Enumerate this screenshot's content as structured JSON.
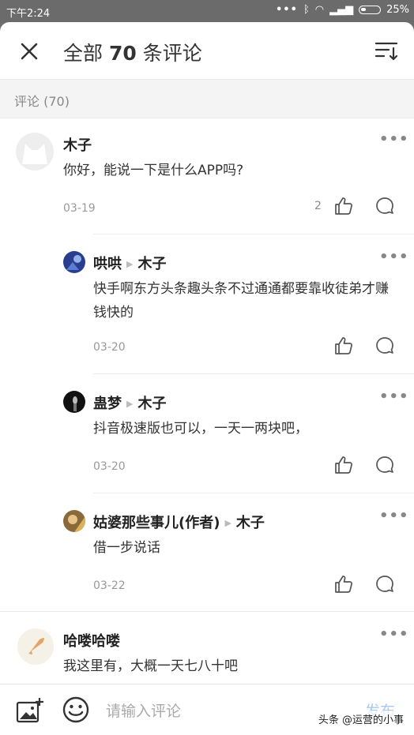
{
  "status_bar": {
    "time": "下午2:24",
    "battery": "25%"
  },
  "header": {
    "title_prefix": "全部",
    "count": "70",
    "title_suffix": "条评论"
  },
  "section": {
    "label": "评论 (70)"
  },
  "comments": [
    {
      "user": "木子",
      "text": "你好，能说一下是什么APP吗?",
      "date": "03-19",
      "likes": "2"
    },
    {
      "user": "哈喽哈喽",
      "text": "我这里有，大概一天七八十吧"
    }
  ],
  "replies": [
    {
      "user": "哄哄",
      "to": "木子",
      "text": "快手啊东方头条趣头条不过通通都要靠收徒弟才赚钱快的",
      "date": "03-20"
    },
    {
      "user": "蛊梦",
      "to": "木子",
      "text": "抖音极速版也可以，一天一两块吧，",
      "date": "03-20"
    },
    {
      "user": "姑婆那些事儿(作者)",
      "to": "木子",
      "text": "借一步说话",
      "date": "03-22"
    }
  ],
  "composer": {
    "placeholder": "请输入评论",
    "send_label": "发布"
  },
  "watermark": "头条 @运营的小事",
  "colors": {
    "send": "#a8c8ee",
    "section_bg": "#f4f4f4"
  }
}
